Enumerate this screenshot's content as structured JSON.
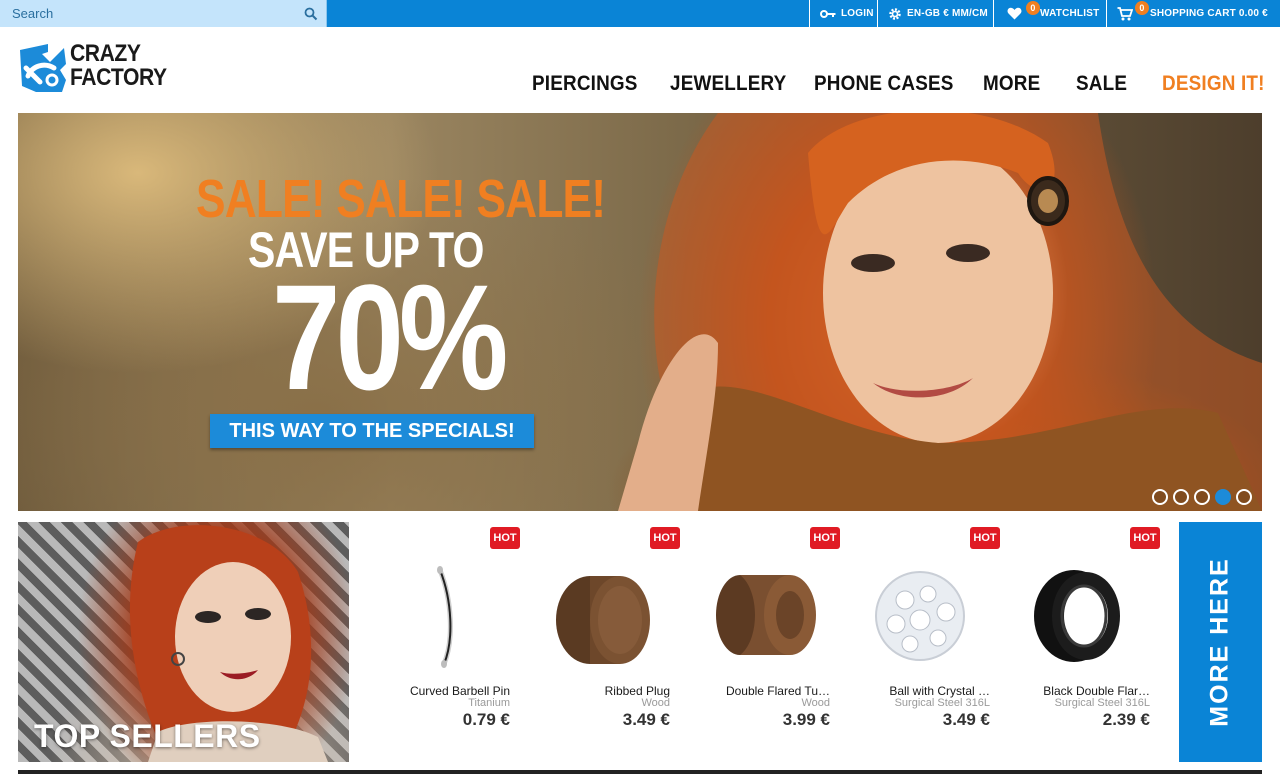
{
  "topbar": {
    "search_placeholder": "Search",
    "login": "LOGIN",
    "locale": "EN-GB € MM/CM",
    "watchlist": "WATCHLIST",
    "watchlist_count": "0",
    "cart": "SHOPPING CART 0.00 €",
    "cart_count": "0"
  },
  "brand": {
    "line1": "CRAZY",
    "line2": "FACTORY",
    "color": "#1c8bd9"
  },
  "nav": {
    "items": [
      "PIERCINGS",
      "JEWELLERY",
      "PHONE CASES",
      "MORE",
      "SALE",
      "DESIGN IT!"
    ],
    "accent": "#f07f21"
  },
  "hero": {
    "line1": "SALE! SALE! SALE!",
    "line2": "SAVE UP TO",
    "line3": "70%",
    "cta": "THIS WAY TO THE SPECIALS!",
    "slides": 5,
    "active_slide": 4
  },
  "top_sellers": {
    "label": "TOP SELLERS"
  },
  "products": [
    {
      "badge": "HOT",
      "name": "Curved Barbell Pin",
      "material": "Titanium",
      "price": "0.79 €",
      "icon": "curved-barbell-icon"
    },
    {
      "badge": "HOT",
      "name": "Ribbed Plug",
      "material": "Wood",
      "price": "3.49 €",
      "icon": "wood-plug-icon"
    },
    {
      "badge": "HOT",
      "name": "Double Flared Tu…",
      "material": "Wood",
      "price": "3.99 €",
      "icon": "wood-tunnel-icon"
    },
    {
      "badge": "HOT",
      "name": "Ball with Crystal …",
      "material": "Surgical Steel 316L",
      "price": "3.49 €",
      "icon": "crystal-ball-icon"
    },
    {
      "badge": "HOT",
      "name": "Black Double Flar…",
      "material": "Surgical Steel 316L",
      "price": "2.39 €",
      "icon": "black-tunnel-icon"
    }
  ],
  "more_here": "MORE HERE",
  "colors": {
    "primary": "#0a84d6",
    "accent": "#f07f21",
    "hot": "#e01b24"
  }
}
